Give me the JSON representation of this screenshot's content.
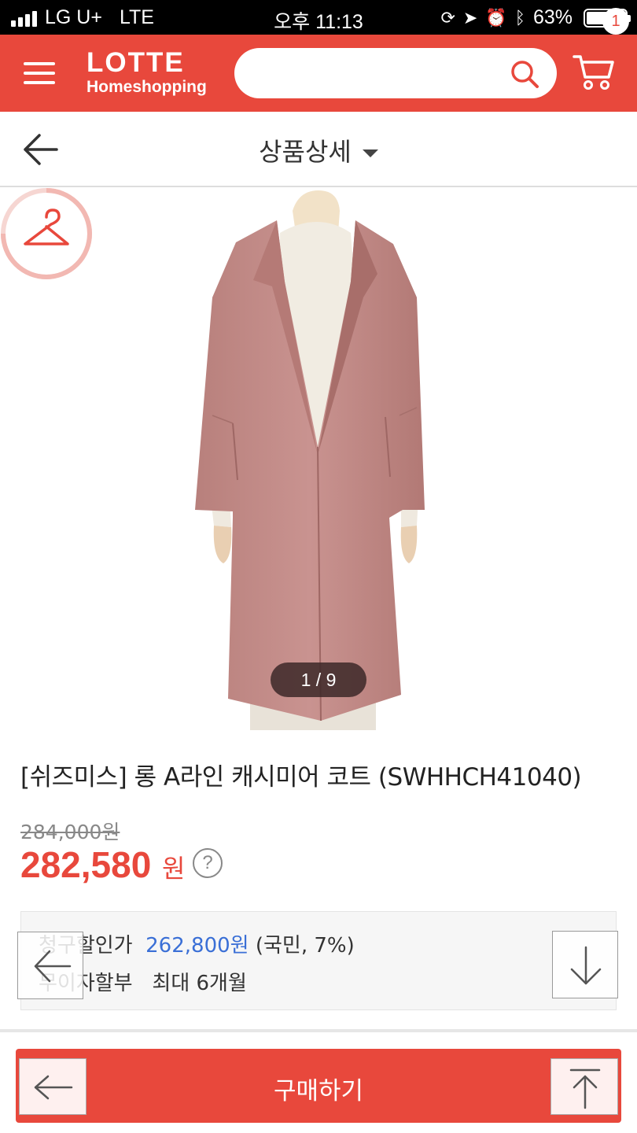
{
  "status_bar": {
    "carrier": "LG U+",
    "network": "LTE",
    "time": "오후 11:13",
    "battery_percent": "63%",
    "battery_level": 0.63
  },
  "header": {
    "logo_line1": "LOTTE",
    "logo_line2": "Homeshopping",
    "search_placeholder": "",
    "cart_count": "1",
    "brand_color": "#e8483c"
  },
  "subheader": {
    "title": "상품상세"
  },
  "gallery": {
    "counter": "1 / 9"
  },
  "product": {
    "name": "[쉬즈미스] 롱 A라인 캐시미어 코트 (SWHHCH41040)",
    "original_price": "284,000원",
    "sale_price": "282,580",
    "sale_unit": "원",
    "help": "?"
  },
  "info": {
    "row1_label": "청구할인가",
    "row1_price": "262,800원",
    "row1_note": "(국민, 7%)",
    "row2_label": "무이자할부",
    "row2_value": "최대 6개월"
  },
  "buy": {
    "label": "구매하기"
  },
  "icons": {
    "menu": "hamburger-icon",
    "search": "search-icon",
    "cart": "cart-icon",
    "back": "arrow-left-icon",
    "hanger": "hanger-icon",
    "down": "arrow-down-icon",
    "top": "arrow-up-icon"
  }
}
